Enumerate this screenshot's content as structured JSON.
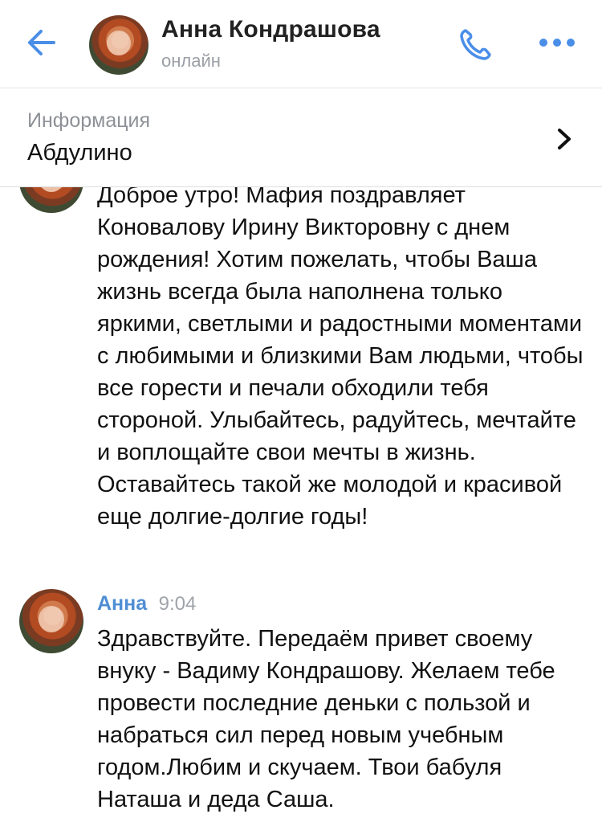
{
  "header": {
    "contact_name": "Анна Кондрашова",
    "status": "онлайн",
    "back_icon": "back-arrow-icon",
    "call_icon": "phone-icon",
    "more_icon": "more-dots-icon",
    "accent_color": "#4a8ee8"
  },
  "info": {
    "title": "Информация",
    "value": "Абдулино",
    "chevron_icon": "chevron-right-icon"
  },
  "messages": [
    {
      "text": "Доброе утро! Мафия поздравляет Коновалову Ирину Викторовну с днем рождения! Хотим пожелать, чтобы Ваша жизнь всегда была наполнена только яркими, светлыми и радостными моментами с любимыми и близкими Вам людьми, чтобы все горести и печали обходили тебя стороной. Улыбайтесь, радуйтесь, мечтайте и воплощайте свои мечты в жизнь. Оставайтесь такой же молодой и красивой еще долгие-долгие годы!"
    },
    {
      "author": "Анна",
      "time": "9:04",
      "text": "Здравствуйте. Передаём привет своему внуку - Вадиму Кондрашову. Желаем тебе провести последние деньки с пользой и набраться сил перед новым учебным годом.Любим и скучаем. Твои бабуля Наташа и деда Саша."
    }
  ]
}
